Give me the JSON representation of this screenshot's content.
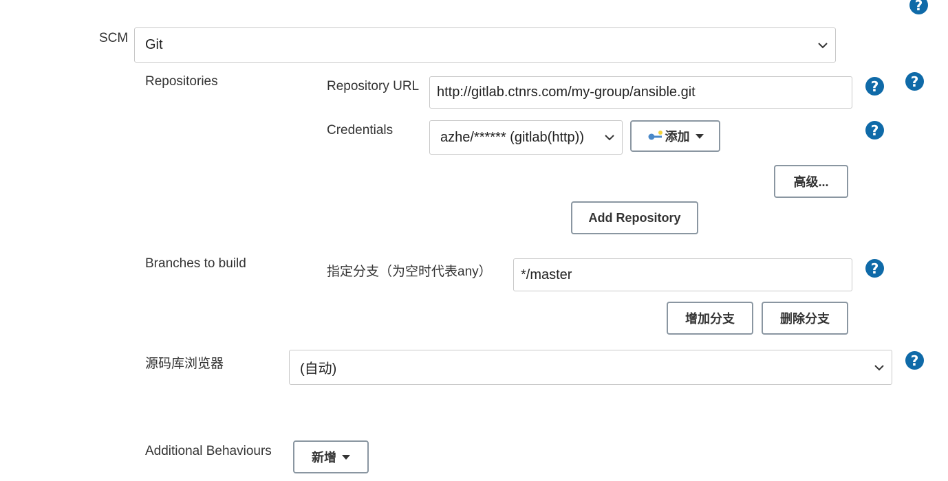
{
  "scm": {
    "label": "SCM",
    "selected": "Git"
  },
  "repositories": {
    "label": "Repositories",
    "url_label": "Repository URL",
    "url_value": "http://gitlab.ctnrs.com/my-group/ansible.git",
    "credentials_label": "Credentials",
    "credentials_selected": "azhe/****** (gitlab(http))",
    "add_credentials_button": "添加",
    "advanced_button": "高级...",
    "add_repository_button": "Add Repository"
  },
  "branches": {
    "label": "Branches to build",
    "specifier_label": "指定分支（为空时代表any）",
    "specifier_value": "*/master",
    "add_branch_button": "增加分支",
    "delete_branch_button": "删除分支"
  },
  "repo_browser": {
    "label": "源码库浏览器",
    "selected": "(自动)"
  },
  "additional_behaviours": {
    "label": "Additional Behaviours",
    "add_button": "新增"
  },
  "help_icon_glyph": "?",
  "colors": {
    "help_icon": "#0f6aa8",
    "button_border": "#8a96a1",
    "input_border": "#c8c8c8"
  }
}
